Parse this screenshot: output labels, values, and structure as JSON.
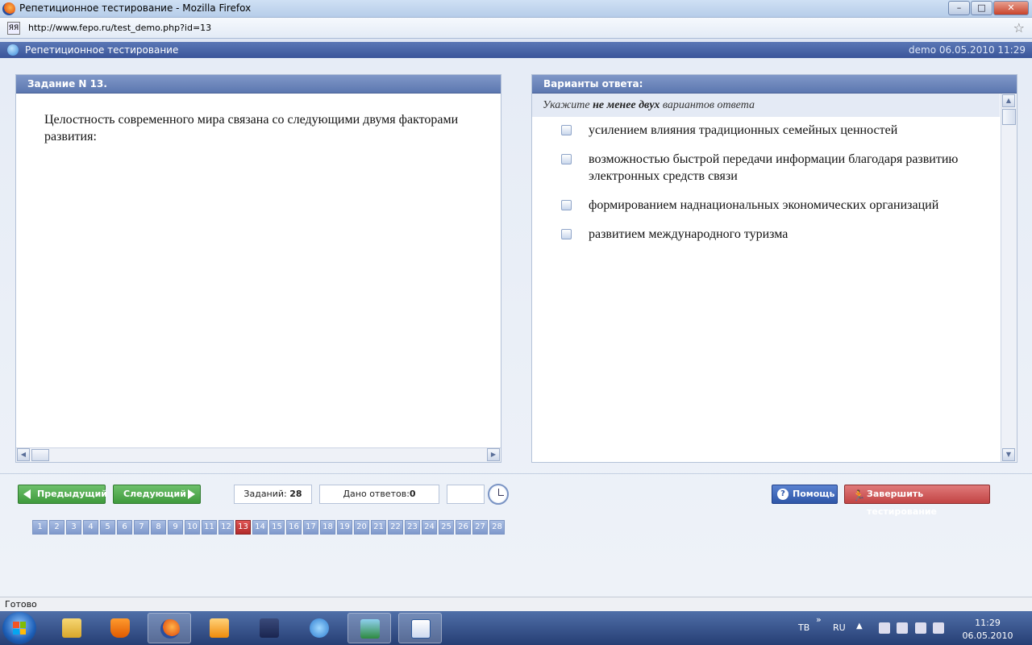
{
  "window": {
    "title": "Репетиционное тестирование - Mozilla Firefox",
    "minimize_glyph": "–",
    "maximize_glyph": "□",
    "close_glyph": "✕"
  },
  "browser": {
    "url": "http://www.fepo.ru/test_demo.php?id=13",
    "site_icon_glyph": "ЯЯ",
    "bookmark_glyph": "☆"
  },
  "app": {
    "title": "Репетиционное тестирование",
    "user_date": "demo 06.05.2010 11:29"
  },
  "task": {
    "header": "Задание N 13.",
    "question": "Целостность современного мира связана со следующими двумя факторами развития:"
  },
  "answers": {
    "header": "Варианты ответа:",
    "instruction_pre": "Укажите ",
    "instruction_bold": "не менее двух",
    "instruction_post": " вариантов ответа",
    "options": [
      "усилением влияния традиционных семейных ценностей",
      "возможностью быстрой передачи информации благодаря развитию электронных средств связи",
      "формированием наднациональных экономических организаций",
      "развитием международного туризма"
    ]
  },
  "controls": {
    "prev_label": "Предыдущий",
    "next_label": "Следующий",
    "tasks_label": "Заданий:",
    "tasks_count": "28",
    "answered_label": "Дано ответов:",
    "answered_count": "0",
    "help_label": "Помощь",
    "help_glyph": "?",
    "finish_label": "Завершить тестирование",
    "finish_glyph": "🏃"
  },
  "pager": {
    "pages": [
      "1",
      "2",
      "3",
      "4",
      "5",
      "6",
      "7",
      "8",
      "9",
      "10",
      "11",
      "12",
      "13",
      "14",
      "15",
      "16",
      "17",
      "18",
      "19",
      "20",
      "21",
      "22",
      "23",
      "24",
      "25",
      "26",
      "27",
      "28"
    ],
    "current": "13"
  },
  "statusbar": {
    "text": "Готово"
  },
  "taskbar": {
    "lang": "ТВ",
    "more": "»",
    "keyboard_lang": "RU",
    "tray_up": "▲",
    "time": "11:29",
    "date": "06.05.2010"
  },
  "colors": {
    "header_blue": "#5c77b0",
    "nav_green": "#3f9a3d",
    "finish_red": "#c24444",
    "current_page": "#b22a2a"
  }
}
